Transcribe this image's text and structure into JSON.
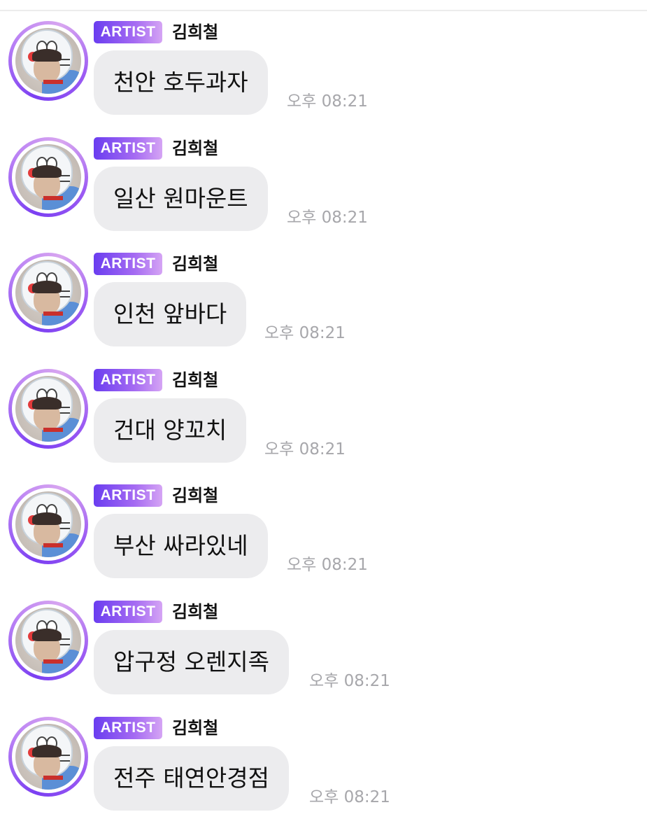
{
  "messages": [
    {
      "badge": "ARTIST",
      "sender": "김희철",
      "text": "천안 호두과자",
      "time": "오후 08:21"
    },
    {
      "badge": "ARTIST",
      "sender": "김희철",
      "text": "일산 원마운트",
      "time": "오후 08:21"
    },
    {
      "badge": "ARTIST",
      "sender": "김희철",
      "text": "인천 앞바다",
      "time": "오후 08:21"
    },
    {
      "badge": "ARTIST",
      "sender": "김희철",
      "text": "건대 양꼬치",
      "time": "오후 08:21"
    },
    {
      "badge": "ARTIST",
      "sender": "김희철",
      "text": "부산 싸라있네",
      "time": "오후 08:21"
    },
    {
      "badge": "ARTIST",
      "sender": "김희철",
      "text": "압구정 오렌지족",
      "time": "오후 08:21"
    },
    {
      "badge": "ARTIST",
      "sender": "김희철",
      "text": "전주 태연안경점",
      "time": "오후 08:21"
    }
  ],
  "colors": {
    "badge_start": "#6a3df0",
    "badge_end": "#d5a4f4",
    "bubble": "#ececee",
    "timestamp": "#a7a7ab",
    "avatar_ring": "#9d5cf3"
  }
}
